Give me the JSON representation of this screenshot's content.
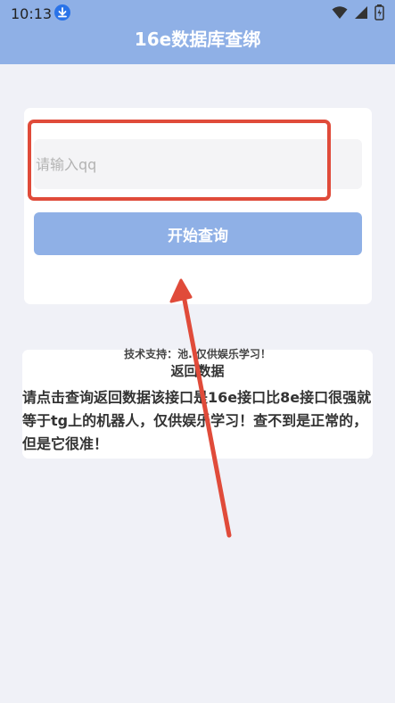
{
  "status_bar": {
    "time": "10:13",
    "icons": [
      "download-icon",
      "wifi-icon",
      "signal-icon",
      "battery-icon"
    ]
  },
  "app": {
    "title": "16e数据库查绑"
  },
  "query_card": {
    "input_placeholder": "请输入qq",
    "input_value": "",
    "button_label": "开始查询"
  },
  "support_text": "技术支持：池. 仅供娱乐学习！",
  "result_card": {
    "title": "返回数据",
    "text": "请点击查询返回数据该接口是16e接口比8e接口很强就等于tg上的机器人，仅供娱乐学习！查不到是正常的，但是它很准！"
  },
  "colors": {
    "accent": "#8fb0e6",
    "highlight": "#e04b3a",
    "background": "#f0f1f7"
  }
}
